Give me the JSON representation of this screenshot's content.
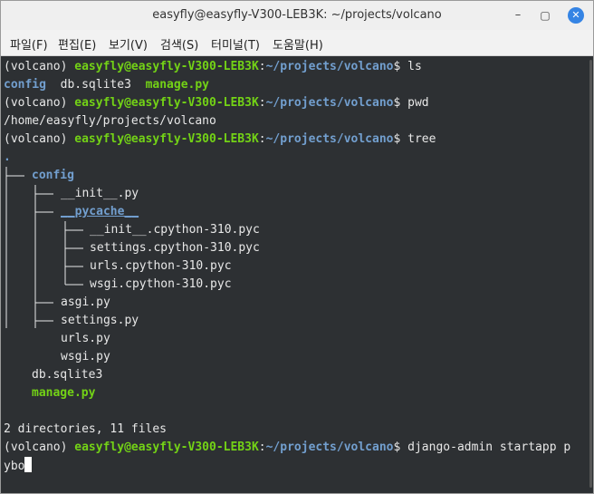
{
  "window": {
    "title": "easyfly@easyfly-V300-LEB3K: ~/projects/volcano"
  },
  "window_controls": {
    "minimize": "–",
    "maximize": "▢",
    "close": "✕"
  },
  "menu": [
    "파일(F)",
    "편집(E)",
    "보기(V)",
    "검색(S)",
    "터미널(T)",
    "도움말(H)"
  ],
  "prompt": {
    "venv": "(volcano)",
    "user_host": "easyfly@easyfly-V300-LEB3K",
    "path": "~/projects/volcano",
    "symbol": "$"
  },
  "commands": {
    "ls": "ls",
    "pwd": "pwd",
    "tree": "tree",
    "startapp_a": "django-admin startapp p",
    "startapp_b": "ybo"
  },
  "ls_output": {
    "dir": "config",
    "file1": "db.sqlite3",
    "file2": "manage.py"
  },
  "pwd_output": "/home/easyfly/projects/volcano",
  "tree": {
    "root": ".",
    "config": "config",
    "init": "__init__.py",
    "pycache": "__pycache__",
    "pyc": [
      "__init__.cpython-310.pyc",
      "settings.cpython-310.pyc",
      "urls.cpython-310.pyc",
      "wsgi.cpython-310.pyc"
    ],
    "config_files": [
      "asgi.py",
      "settings.py",
      "urls.py",
      "wsgi.py"
    ],
    "db": "db.sqlite3",
    "manage": "manage.py",
    "summary": "2 directories, 11 files"
  },
  "colors": {
    "prompt_green": "#73d216",
    "path_blue": "#729fcf",
    "background": "#2d3033",
    "text": "#e8e8e8"
  }
}
